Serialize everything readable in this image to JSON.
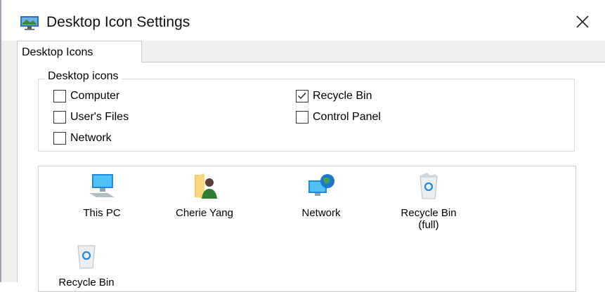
{
  "window": {
    "title": "Desktop Icon Settings",
    "app_icon": "desktop-settings-icon",
    "close_icon": "close-icon"
  },
  "tabs": [
    {
      "label": "Desktop Icons",
      "selected": true
    }
  ],
  "group": {
    "legend": "Desktop icons",
    "checkboxes": [
      {
        "label": "Computer",
        "checked": false
      },
      {
        "label": "Recycle Bin",
        "checked": true
      },
      {
        "label": "User's Files",
        "checked": false
      },
      {
        "label": "Control Panel",
        "checked": false
      },
      {
        "label": "Network",
        "checked": false
      }
    ]
  },
  "icons": [
    {
      "label": "This PC",
      "icon": "computer-icon"
    },
    {
      "label": "Cherie Yang",
      "icon": "user-folder-icon"
    },
    {
      "label": "Network",
      "icon": "network-icon"
    },
    {
      "label": "Recycle Bin\n(full)",
      "icon": "recycle-bin-full-icon"
    },
    {
      "label": "Recycle Bin",
      "icon": "recycle-bin-empty-icon"
    }
  ]
}
